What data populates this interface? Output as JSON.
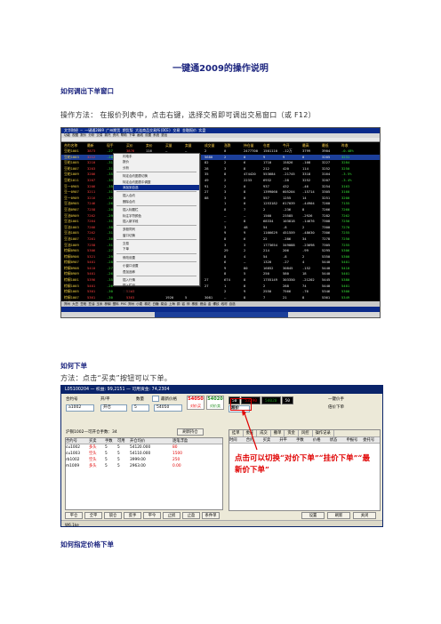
{
  "doc": {
    "title": "一键通2009的操作说明",
    "section1_heading": "如何调出下单窗口",
    "section1_text": "操作方法：  在报价列表中，点击右键，选择交易即可调出交易窗口（或 F12）",
    "section2_heading": "如何下单",
    "section2_text": "方法：点击“买卖”按钮可以下单。",
    "section3_heading": "如何指定价格下单"
  },
  "terminal": {
    "titlebar": "文华财经 — 一键通2009   广州期货  期货版  大连商品交易所(DCE)  交易  金融报价  实盘",
    "menubar": "功能   视图   报价   分析   交易   委托   资讯   帮助   下单   画线   设置   系统   退出",
    "columns": [
      "合约名称",
      "最新",
      "现手",
      "买价",
      "卖价",
      "买量",
      "卖量",
      "成交量",
      "涨跌",
      "持仓量",
      "仓差",
      "今开",
      "最高",
      "最低",
      "昨收"
    ],
    "rows": [
      {
        "name": "豆粕1001",
        "c": [
          "3873",
          "-27",
          "3876",
          "116",
          "—",
          "—",
          "2",
          "0",
          "2477700",
          "1501110",
          "-12万",
          "3799",
          "3904",
          "-0.48%"
        ]
      },
      {
        "name": "豆粕1003",
        "c": [
          "3212",
          "-28",
          "3215",
          "",
          "1450",
          "1",
          "5680",
          "2",
          "0",
          "9",
          "9",
          "0",
          "3205",
          "3231"
        ]
      },
      {
        "name": "豆粕1005",
        "c": [
          "3210",
          "-31",
          "3212",
          "",
          "",
          "",
          "82",
          "2",
          "6",
          "1710",
          "15826",
          "-108",
          "3227",
          "3284"
        ]
      },
      {
        "name": "豆粕1007",
        "c": [
          "3203",
          "-31",
          "3205",
          "",
          "",
          "",
          "28",
          "3",
          "8",
          "212",
          "420",
          "114",
          "3252",
          "3250"
        ]
      },
      {
        "name": "豆粕1009",
        "c": [
          "3206",
          "-35",
          "3208",
          "",
          "",
          "",
          "35",
          "8",
          "474420",
          "553684",
          "-21745",
          "3318",
          "3164",
          "-3.5%"
        ]
      },
      {
        "name": "豆粕1011",
        "c": [
          "3207",
          "-33",
          "3209",
          "",
          "",
          "",
          "49",
          "2",
          "2233",
          "6932",
          "-28",
          "3252",
          "3207",
          "-3.4%"
        ]
      },
      {
        "name": "豆一0905",
        "c": [
          "3206",
          "-35",
          "3210",
          "",
          "",
          "",
          "91",
          "2",
          "0",
          "937",
          "432",
          "-46",
          "3254",
          "3163"
        ]
      },
      {
        "name": "豆一0907",
        "c": [
          "3211",
          "-31",
          "3213",
          "",
          "",
          "",
          "27",
          "3",
          "8",
          "1399060",
          "605204",
          "-15714",
          "3305",
          "3160"
        ]
      },
      {
        "name": "豆一0909",
        "c": [
          "3216",
          "-32",
          "3218",
          "",
          "",
          "",
          "88",
          "3",
          "0",
          "557",
          "1255",
          "14",
          "3251",
          "3200"
        ]
      },
      {
        "name": "豆油0905",
        "c": [
          "7246",
          "-26",
          "7248",
          "",
          "",
          "",
          "",
          "1",
          "0",
          "1253182",
          "617039",
          "-44904",
          "7260",
          "7155"
        ]
      },
      {
        "name": "豆油0907",
        "c": [
          "7258",
          "-20",
          "7260",
          "",
          "",
          "",
          "",
          "8",
          "7",
          "2",
          "-236",
          "8",
          "7266",
          "7260"
        ]
      },
      {
        "name": "豆油0909",
        "c": [
          "7262",
          "-29",
          "7266",
          "",
          "",
          "",
          "",
          "—",
          "—",
          "1560",
          "23585",
          "-2926",
          "7282",
          "7262"
        ]
      },
      {
        "name": "豆油1001",
        "c": [
          "7264",
          "-31",
          "7268",
          "",
          "",
          "",
          "",
          "—",
          "8",
          "68334",
          "103818",
          "-14676",
          "7308",
          "7250"
        ]
      },
      {
        "name": "豆油1003",
        "c": [
          "7266",
          "-30",
          "7270",
          "",
          "",
          "",
          "",
          "3",
          "48",
          "54",
          "-8",
          "2",
          "7300",
          "7270"
        ]
      },
      {
        "name": "豆油1005",
        "c": [
          "7262",
          "-31",
          "7266",
          "",
          "",
          "",
          "",
          "9",
          "9",
          "1166629",
          "451559",
          "-48630",
          "7306",
          "7255"
        ]
      },
      {
        "name": "豆油1007",
        "c": [
          "7261",
          "-30",
          "7264",
          "",
          "",
          "",
          "",
          "8",
          "6",
          "22",
          "-286",
          "34",
          "7278",
          "7250"
        ]
      },
      {
        "name": "豆油1009",
        "c": [
          "7258",
          "-31",
          "7262",
          "",
          "",
          "",
          "",
          "3",
          "3",
          "1773654",
          "349088",
          "-23698",
          "7305",
          "7255"
        ]
      },
      {
        "name": "棕榈0905",
        "c": [
          "5306",
          "-27",
          "5310",
          "",
          "",
          "",
          "",
          "29",
          "2",
          "214",
          "206",
          "-99",
          "5295",
          "5306"
        ]
      },
      {
        "name": "棕榈0906",
        "c": [
          "5321",
          "-29",
          "5324",
          "",
          "",
          "",
          "",
          "8",
          "4",
          "54",
          "-8",
          "2",
          "5350",
          "5300"
        ]
      },
      {
        "name": "棕榈0907",
        "c": [
          "5401",
          "-28",
          "5403",
          "",
          "",
          "",
          "",
          "6",
          "—",
          "1320",
          "-27",
          "4",
          "5440",
          "5401"
        ]
      },
      {
        "name": "棕榈0908",
        "c": [
          "5410",
          "-27",
          "5412",
          "",
          "",
          "",
          "",
          "9",
          "80",
          "16852",
          "30845",
          "-152",
          "5440",
          "5410"
        ]
      },
      {
        "name": "棕榈0909",
        "c": [
          "5401",
          "-26",
          "5403",
          "",
          "",
          "",
          "",
          "8",
          "5",
          "250",
          "580",
          "18",
          "5440",
          "5401"
        ]
      },
      {
        "name": "棕榈1001",
        "c": [
          "5396",
          "-35",
          "5398",
          "",
          "",
          "",
          "27",
          "674",
          "8",
          "1755149",
          "303350",
          "-21202",
          "5445",
          "5380"
        ]
      },
      {
        "name": "棕榈1003",
        "c": [
          "5401",
          "-26",
          "5403",
          "",
          "",
          "",
          "27",
          "1",
          "8",
          "2",
          "288",
          "74",
          "5440",
          "5401"
        ]
      },
      {
        "name": "棕榈1005",
        "c": [
          "5301",
          "-30",
          "5303",
          "",
          "",
          "",
          "",
          "2",
          "9",
          "2550",
          "7566",
          "-76",
          "5346",
          "5300"
        ]
      },
      {
        "name": "棕榈1007",
        "c": [
          "5361",
          "-30",
          "5363",
          "",
          "1920",
          "5",
          "3081",
          "—",
          "8",
          "7",
          "21",
          "8",
          "5361",
          "5349"
        ]
      },
      {
        "name": "棕榈1009",
        "c": [
          "5371",
          "-29",
          "5373",
          "",
          "1923",
          "8",
          "3082",
          "8",
          "8",
          "2",
          "21.6",
          "2",
          "5380",
          "5360"
        ]
      }
    ],
    "menu": [
      "闪电手",
      "报价",
      "分析",
      "",
      "特定合约图表切换",
      "特定合约图表中调整",
      "添加到自选",
      "",
      "插入合约",
      "删除合约",
      "",
      "插入标题栏",
      "标注字符颜色",
      "插入新字段",
      "",
      "多股同列",
      "窗口切换",
      "",
      "交易",
      "下单",
      "",
      "修改设置",
      "",
      "小窗口设置",
      "叠加品种",
      "",
      "插入行情",
      "插入栏目",
      "删除栏目"
    ],
    "menu_highlight_index": 6,
    "footer_text": "郑州 大豆  豆粕  豆油  玉米  棕榈  塑料  PVC  郑州  小麦  棉花  白糖  菜油  上海  铜  铝  锌  橡胶  燃油  金  螺纹  线材  自选",
    "status_left": "成交 3: 10 ... 点击 交易指令..."
  },
  "order": {
    "titlebar": "L05100204 — 权益: 99,2151 — 可用资金: 74,2304",
    "label_contract": "合约号",
    "contract_value": "a1002",
    "label_open": "开/平",
    "open_value": "开仓",
    "label_qty": "数量",
    "qty_value": "5",
    "label_price": "价格",
    "price_value": "54050",
    "auto_label": "最新价格",
    "check_label": "一键价手",
    "check_label2": "倍价下单",
    "buy_price": "54050",
    "buy_caption": "对价买",
    "sell_price": "54020",
    "sell_caption": "对价卖",
    "quote_cells": [
      "50",
      "53290",
      "54020",
      "50"
    ],
    "account_line": "沪铜1002—可开仓手数：34",
    "refresh_btn": "刷新持仓",
    "position_headers": [
      "合约号",
      "买卖",
      "手数",
      "可用",
      "开仓均价",
      "逐笔浮盈"
    ],
    "positions": [
      {
        "code": "cu1002",
        "side": "多头",
        "qty": "5",
        "avail": "5",
        "price": "54120.000",
        "pnl": "80"
      },
      {
        "code": "cu1003",
        "side": "空头",
        "qty": "5",
        "avail": "5",
        "price": "54110.000",
        "pnl": "1500"
      },
      {
        "code": "rb1002",
        "side": "空头",
        "qty": "5",
        "avail": "5",
        "price": "3999.00",
        "pnl": "250"
      },
      {
        "code": "m1009",
        "side": "多头",
        "qty": "5",
        "avail": "5",
        "price": "2963.00",
        "pnl": "0.00"
      }
    ],
    "tabs": [
      "挂单",
      "委托",
      "成交",
      "撤单",
      "资金",
      "风控",
      "操作记录"
    ],
    "tab_buttons": [
      "刷新",
      "全撤"
    ],
    "right_headers": [
      "时间",
      "合约",
      "买卖",
      "开平",
      "手数",
      "价格",
      "状态",
      "申报号",
      "委托号"
    ],
    "annotation": "点击可以切换“对价下单”“挂价下单”“最新价下单”",
    "bottom_buttons": [
      "平仓",
      "全平",
      "锁仓",
      "反手",
      "平今",
      "止损",
      "止盈",
      "条件单"
    ],
    "bottom_right_buttons": [
      "设置",
      "刷新",
      "关闭"
    ],
    "status_bar": "W6.1ke"
  }
}
